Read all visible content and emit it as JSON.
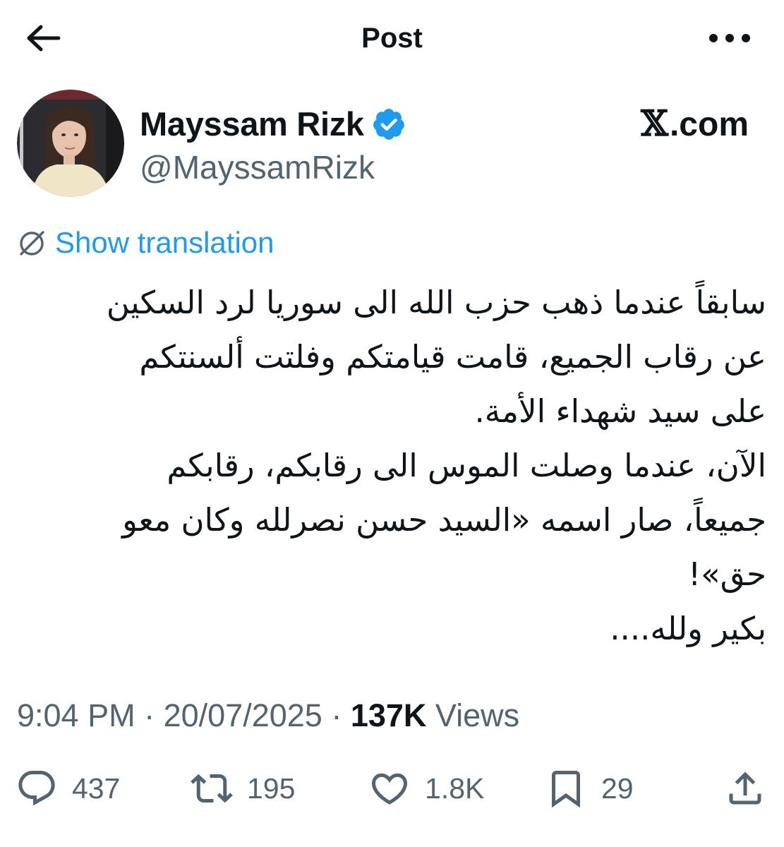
{
  "header": {
    "title": "Post",
    "back_icon": "arrow-left-icon",
    "more_icon": "more-horizontal-icon"
  },
  "author": {
    "display_name": "Mayssam Rizk",
    "handle": "@MayssamRizk",
    "verified": true,
    "verified_color": "#1d9bf0"
  },
  "watermark": {
    "logo": "𝕏",
    "text": ".com"
  },
  "translation": {
    "label": "Show translation",
    "color": "#1d9bf0"
  },
  "tweet": {
    "lines": [
      "سابقاً عندما ذهب حزب الله الى سوريا لرد السكين",
      "عن رقاب الجميع، قامت قيامتكم وفلتت ألسنتكم",
      "على سيد شهداء الأمة.",
      "الآن، عندما وصلت الموس الى رقابكم، رقابكم",
      "جميعاً، صار اسمه «السيد حسن نصرلله وكان معو",
      "حق»!",
      "بكير ولله...."
    ]
  },
  "meta": {
    "time": "9:04 PM",
    "separator": " · ",
    "date": "20/07/2025",
    "views_count": "137K",
    "views_label": " Views"
  },
  "actions": {
    "replies": "437",
    "reposts": "195",
    "likes": "1.8K",
    "bookmarks": "29"
  },
  "colors": {
    "text_primary": "#0f1419",
    "text_secondary": "#536471",
    "accent": "#1d9bf0"
  }
}
